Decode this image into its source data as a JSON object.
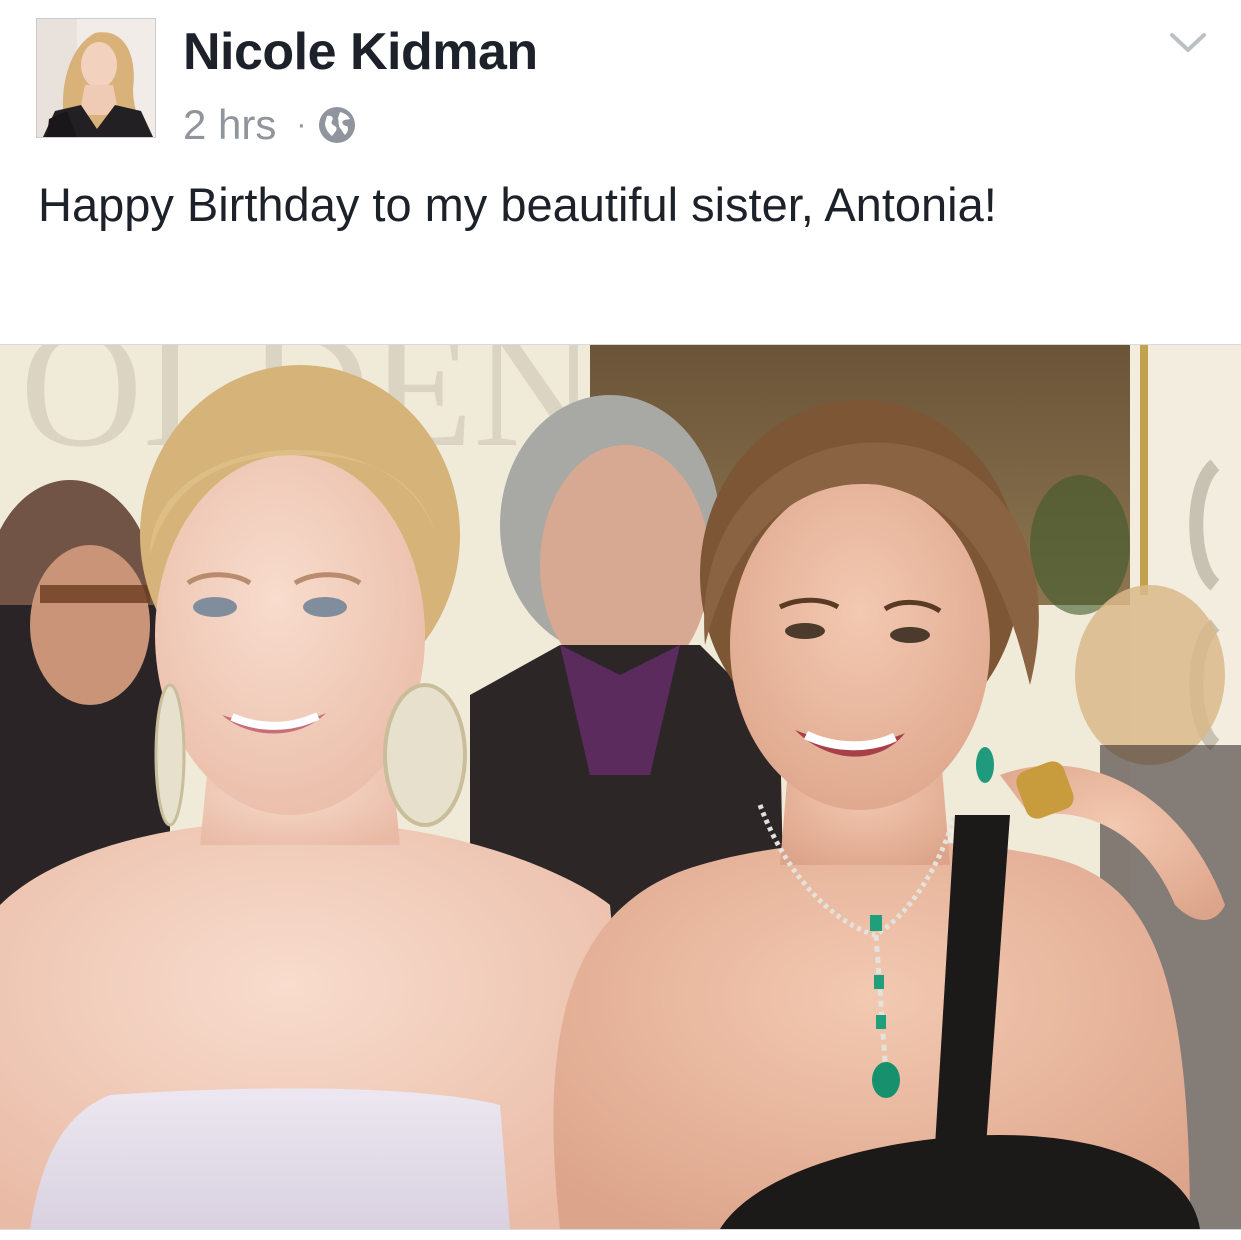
{
  "post": {
    "author": {
      "name": "Nicole Kidman",
      "avatar_icon": "profile-photo"
    },
    "meta": {
      "time": "2 hrs",
      "separator": "·",
      "audience_icon": "globe-icon"
    },
    "menu_icon": "chevron-down-icon",
    "message": "Happy Birthday to my beautiful sister, Antonia!",
    "photo": {
      "background_text": "OLDEN"
    }
  },
  "colors": {
    "name": "#1d2129",
    "meta": "#90949c",
    "border": "#d7d9dd"
  }
}
